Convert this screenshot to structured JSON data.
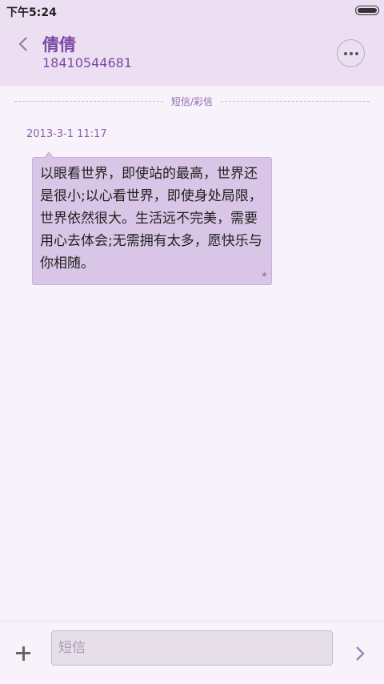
{
  "status_bar": {
    "time": "下午5:24",
    "battery_level": 1.0
  },
  "header": {
    "contact_name": "倩倩",
    "contact_number": "18410544681"
  },
  "conversation": {
    "divider_label": "短信/彩信",
    "messages": [
      {
        "timestamp": "2013-3-1 11:17",
        "text": "以眼看世界，即使站的最高，世界还是很小;以心看世界，即使身处局限，世界依然很大。生活远不完美，需要用心去体会;无需拥有太多，愿快乐与你相随。"
      }
    ]
  },
  "composer": {
    "placeholder": "短信",
    "value": ""
  },
  "colors": {
    "accent": "#7a4aa6",
    "header_bg": "#ecdff2",
    "bubble_bg": "#d9c6e6",
    "page_bg": "#f8f3fa"
  },
  "icons": {
    "back": "chevron-left-icon",
    "more": "more-dots-icon",
    "add": "plus-icon",
    "send": "chevron-right-icon",
    "battery": "battery-icon",
    "star": "star-icon"
  }
}
